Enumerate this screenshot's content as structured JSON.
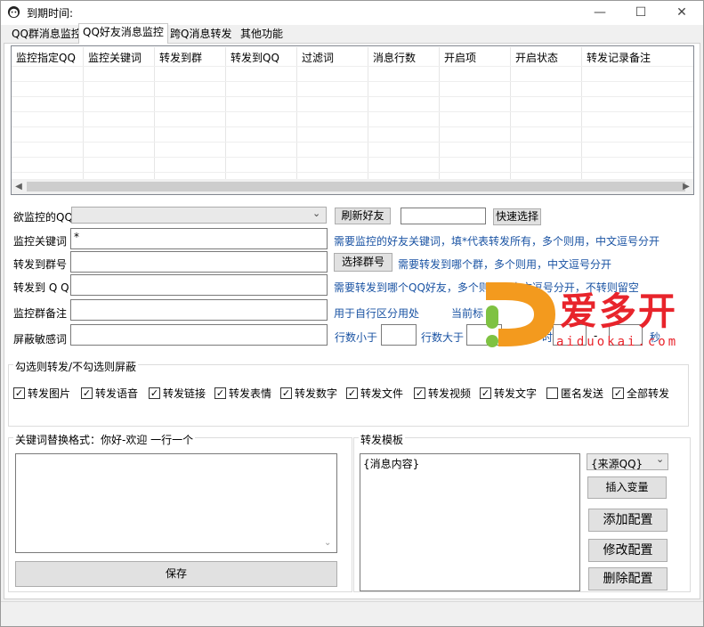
{
  "window": {
    "title": "到期时间:",
    "minimize": "—",
    "maximize": "☐",
    "close": "✕"
  },
  "tabs": [
    {
      "label": "QQ群消息监控"
    },
    {
      "label": "QQ好友消息监控"
    },
    {
      "label": "跨Q消息转发"
    },
    {
      "label": "其他功能"
    }
  ],
  "active_tab": 1,
  "table": {
    "columns": [
      "监控指定QQ",
      "监控关键词",
      "转发到群",
      "转发到QQ",
      "过滤词",
      "消息行数",
      "开启项",
      "开启状态",
      "转发记录备注"
    ],
    "rows": []
  },
  "form": {
    "watch_qq_label": "欲监控的QQ",
    "watch_qq_value": "",
    "refresh_friends_btn": "刷新好友",
    "quick_select_value": "",
    "quick_select_btn": "快速选择",
    "keyword_label": "监控关键词",
    "keyword_value": "*",
    "keyword_hint": "需要监控的好友关键词，填*代表转发所有，多个则用，中文逗号分开",
    "to_group_label": "转发到群号",
    "to_group_value": "",
    "select_group_btn": "选择群号",
    "to_group_hint": "需要转发到哪个群，多个则用，中文逗号分开",
    "to_qq_label": "转发到 Q Q",
    "to_qq_value": "",
    "to_qq_hint": "需要转发到哪个QQ好友，多个则用，中文逗号分开，不转则留空",
    "remark_label": "监控群备注",
    "remark_value": "",
    "remark_hint": "用于自行区分用处",
    "current_label": "当前标",
    "filter_label": "屏蔽敏感词",
    "filter_value": "",
    "rows_less_label": "行数小于",
    "rows_less_value": "",
    "rows_more_label": "行数大于",
    "rows_more_value": "",
    "time_label": "时",
    "time_from": "",
    "dash": "-",
    "time_to": "",
    "seconds_label": "秒"
  },
  "checks": {
    "group_title": "勾选则转发/不勾选则屏蔽",
    "items": [
      {
        "label": "转发图片",
        "checked": true
      },
      {
        "label": "转发语音",
        "checked": true
      },
      {
        "label": "转发链接",
        "checked": true
      },
      {
        "label": "转发表情",
        "checked": true
      },
      {
        "label": "转发数字",
        "checked": true
      },
      {
        "label": "转发文件",
        "checked": true
      },
      {
        "label": "转发视频",
        "checked": true
      },
      {
        "label": "转发文字",
        "checked": true
      },
      {
        "label": "匿名发送",
        "checked": false
      },
      {
        "label": "全部转发",
        "checked": true
      }
    ]
  },
  "replace": {
    "title": "关键词替换格式：你好-欢迎 一行一个",
    "value": "",
    "save_btn": "保存"
  },
  "template": {
    "title": "转发模板",
    "value": "{消息内容}",
    "var_select": "{来源QQ}",
    "insert_btn": "插入变量",
    "add_btn": "添加配置",
    "edit_btn": "修改配置",
    "delete_btn": "删除配置"
  },
  "watermark": {
    "text": "爱多开",
    "url": "aiduokai.com"
  },
  "colors": {
    "hint": "#1a53a3",
    "brand": "#e8242b",
    "brand_orange": "#f39a1e",
    "brand_green": "#7fc242"
  }
}
